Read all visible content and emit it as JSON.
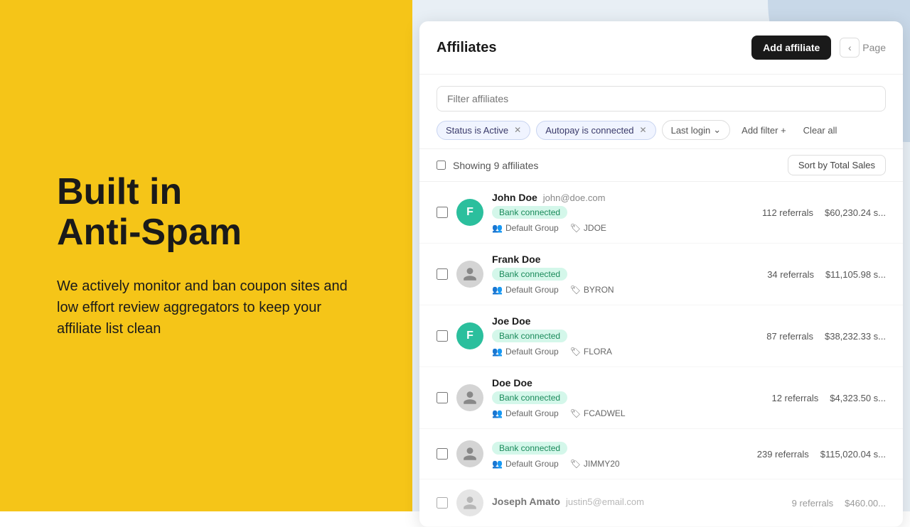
{
  "leftPanel": {
    "title": "Built in\nAnti-Spam",
    "description": "We actively monitor and ban coupon sites and low effort review aggregators to keep your affiliate list clean"
  },
  "rightPanel": {
    "cardTitle": "Affiliates",
    "addAffiliateBtn": "Add affiliate",
    "pageLabel": "Page",
    "searchPlaceholder": "Filter affiliates",
    "filters": [
      {
        "label": "Status is Active",
        "removable": true
      },
      {
        "label": "Autopay is connected",
        "removable": true
      },
      {
        "label": "Last login",
        "dropdown": true
      }
    ],
    "addFilterBtn": "Add filter +",
    "clearAllBtn": "Clear all",
    "showingLabel": "Showing 9 affiliates",
    "sortBtn": "Sort by Total Sales",
    "affiliates": [
      {
        "id": 1,
        "name": "John Doe",
        "email": "john@doe.com",
        "avatar": "F",
        "avatarType": "teal",
        "bankConnected": true,
        "group": "Default Group",
        "coupon": "JDOE",
        "referrals": "112 referrals",
        "sales": "$60,230.24 s..."
      },
      {
        "id": 2,
        "name": "Frank Doe",
        "email": "",
        "avatar": null,
        "avatarType": "gray-icon",
        "bankConnected": true,
        "group": "Default Group",
        "coupon": "BYRON",
        "referrals": "34 referrals",
        "sales": "$11,105.98 s..."
      },
      {
        "id": 3,
        "name": "Joe Doe",
        "email": "",
        "avatar": "F",
        "avatarType": "teal",
        "bankConnected": true,
        "group": "Default Group",
        "coupon": "FLORA",
        "referrals": "87 referrals",
        "sales": "$38,232.33 s..."
      },
      {
        "id": 4,
        "name": "Doe Doe",
        "email": "",
        "avatar": null,
        "avatarType": "gray-icon",
        "bankConnected": true,
        "group": "Default Group",
        "coupon": "FCADWEL",
        "referrals": "12 referrals",
        "sales": "$4,323.50 s..."
      },
      {
        "id": 5,
        "name": "",
        "email": "",
        "avatar": null,
        "avatarType": "gray-icon",
        "bankConnected": true,
        "group": "Default Group",
        "coupon": "JIMMY20",
        "referrals": "239 referrals",
        "sales": "$115,020.04 s..."
      }
    ]
  }
}
